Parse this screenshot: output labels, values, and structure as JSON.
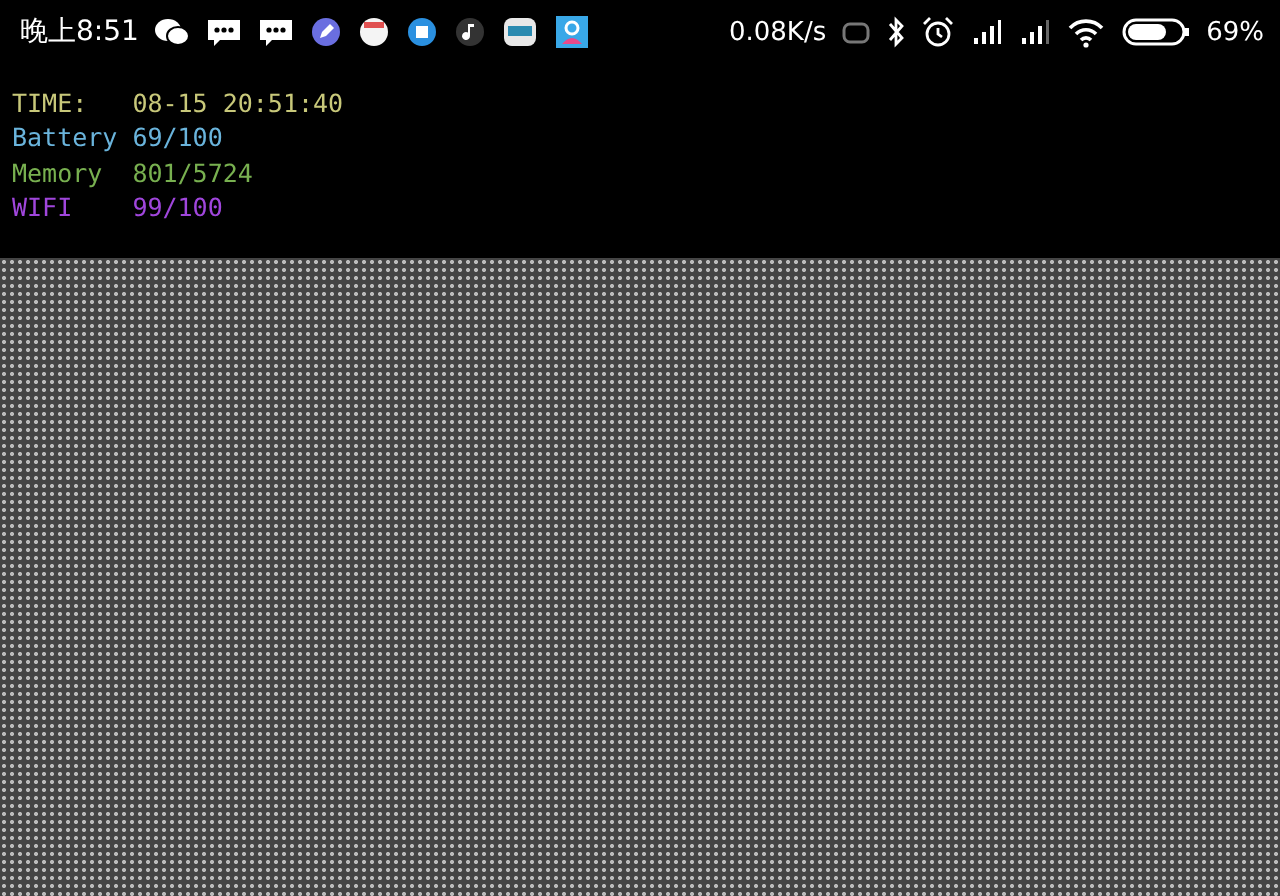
{
  "status_bar": {
    "time": "晚上8:51",
    "speed": "0.08K/s",
    "battery": "69%"
  },
  "terminal": {
    "lines": [
      {
        "label": "TIME:",
        "value": "08-15 20:51:40",
        "color": "#c8c87a"
      },
      {
        "label": "Battery",
        "value": "69/100",
        "color": "#6ab4dc"
      },
      {
        "label": "Memory",
        "value": "801/5724",
        "color": "#78b050"
      },
      {
        "label": "WIFI",
        "value": "99/100",
        "color": "#a046dc"
      }
    ]
  }
}
